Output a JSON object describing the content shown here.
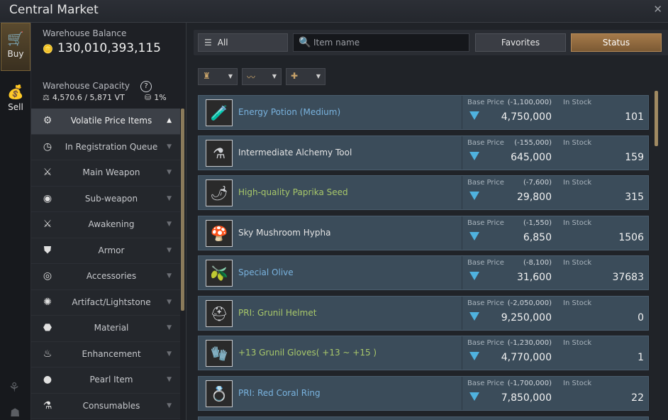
{
  "window": {
    "title": "Central Market",
    "close_icon": "close-icon"
  },
  "nav": {
    "buy_label": "Buy",
    "sell_label": "Sell"
  },
  "warehouse": {
    "balance_label": "Warehouse Balance",
    "balance_value": "130,010,393,115",
    "capacity_label": "Warehouse Capacity",
    "help_symbol": "?",
    "capacity_value": "4,570.6 / 5,871 VT",
    "capacity_percent": "1%"
  },
  "categories": [
    {
      "label": "Volatile Price Items",
      "icon": "gear-icon",
      "glyph": "⚙",
      "active": true,
      "arrow": "▲"
    },
    {
      "label": "In Registration Queue",
      "icon": "clock-icon",
      "glyph": "◷",
      "active": false,
      "arrow": "▼"
    },
    {
      "label": "Main Weapon",
      "icon": "sword-icon",
      "glyph": "⚔",
      "active": false,
      "arrow": "▼"
    },
    {
      "label": "Sub-weapon",
      "icon": "shield-icon",
      "glyph": "◉",
      "active": false,
      "arrow": "▼"
    },
    {
      "label": "Awakening",
      "icon": "blade-icon",
      "glyph": "⚔",
      "active": false,
      "arrow": "▼"
    },
    {
      "label": "Armor",
      "icon": "armor-icon",
      "glyph": "⛊",
      "active": false,
      "arrow": "▼"
    },
    {
      "label": "Accessories",
      "icon": "ring-icon",
      "glyph": "◎",
      "active": false,
      "arrow": "▼"
    },
    {
      "label": "Artifact/Lightstone",
      "icon": "lightstone-icon",
      "glyph": "✺",
      "active": false,
      "arrow": "▼"
    },
    {
      "label": "Material",
      "icon": "material-icon",
      "glyph": "⬣",
      "active": false,
      "arrow": "▼"
    },
    {
      "label": "Enhancement",
      "icon": "flame-icon",
      "glyph": "♨",
      "active": false,
      "arrow": "▼"
    },
    {
      "label": "Pearl Item",
      "icon": "pearl-icon",
      "glyph": "●",
      "active": false,
      "arrow": "▼"
    },
    {
      "label": "Consumables",
      "icon": "potion-icon",
      "glyph": "⚗",
      "active": false,
      "arrow": "▼"
    }
  ],
  "toolbar": {
    "all_label": "All",
    "search_placeholder": "Item name",
    "favorites_label": "Favorites",
    "status_label": "Status"
  },
  "columns": {
    "base_price": "Base Price",
    "in_stock": "In Stock"
  },
  "items": [
    {
      "name": "Energy Potion (Medium)",
      "color": "blue",
      "icon": "energy-potion-icon",
      "glyph": "🧪",
      "change": "(-1,100,000)",
      "price": "4,750,000",
      "stock": "101"
    },
    {
      "name": "Intermediate Alchemy Tool",
      "color": "white",
      "icon": "alchemy-tool-icon",
      "glyph": "⚗",
      "change": "(-155,000)",
      "price": "645,000",
      "stock": "159"
    },
    {
      "name": "High-quality Paprika Seed",
      "color": "green",
      "icon": "paprika-seed-icon",
      "glyph": "🌶",
      "change": "(-7,600)",
      "price": "29,800",
      "stock": "315"
    },
    {
      "name": "Sky Mushroom Hypha",
      "color": "white",
      "icon": "mushroom-hypha-icon",
      "glyph": "🍄",
      "change": "(-1,550)",
      "price": "6,850",
      "stock": "1506"
    },
    {
      "name": "Special Olive",
      "color": "blue",
      "icon": "olive-icon",
      "glyph": "🫒",
      "change": "(-8,100)",
      "price": "31,600",
      "stock": "37683"
    },
    {
      "name": "PRI: Grunil Helmet",
      "color": "green",
      "icon": "helmet-icon",
      "glyph": "⛑",
      "change": "(-2,050,000)",
      "price": "9,250,000",
      "stock": "0"
    },
    {
      "name": "+13 Grunil Gloves( +13 ~ +15 )",
      "color": "green",
      "icon": "gloves-icon",
      "glyph": "🧤",
      "change": "(-1,230,000)",
      "price": "4,770,000",
      "stock": "1"
    },
    {
      "name": "PRI: Red Coral Ring",
      "color": "blue",
      "icon": "ring-icon",
      "glyph": "💍",
      "change": "(-1,700,000)",
      "price": "7,850,000",
      "stock": "22"
    }
  ],
  "colors": {
    "row_bg": "#3b4c5a",
    "name_blue": "#79b3df",
    "name_green": "#a8c86a",
    "down_arrow": "#4fb2df",
    "status_accent": "#a57a4a"
  }
}
